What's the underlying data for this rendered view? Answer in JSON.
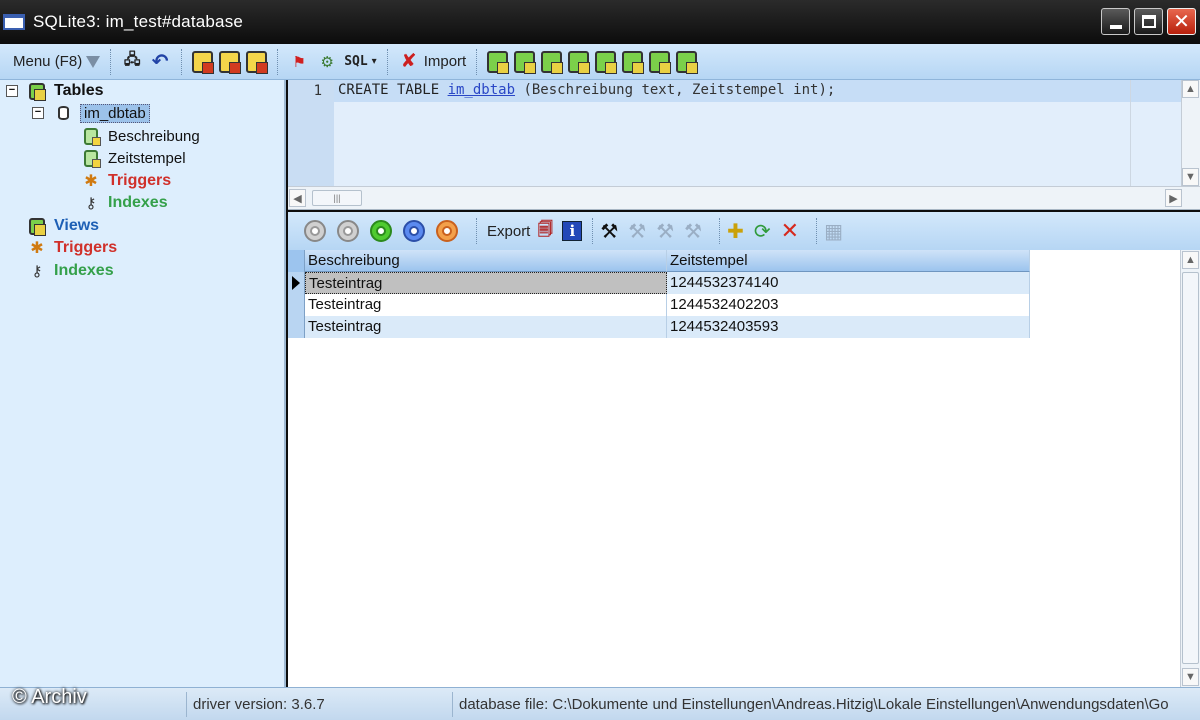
{
  "window": {
    "title": "SQLite3: im_test#database"
  },
  "toolbar": {
    "menu_label": "Menu (F8)",
    "sql_label": "SQL",
    "import_label": "Import"
  },
  "tree": {
    "tables": "Tables",
    "table_name": "im_dbtab",
    "column_1": "Beschreibung",
    "column_2": "Zeitstempel",
    "sub_triggers": "Triggers",
    "sub_indexes": "Indexes",
    "views": "Views",
    "triggers": "Triggers",
    "indexes": "Indexes"
  },
  "editor": {
    "line_number": "1",
    "kw_create": "CREATE TABLE ",
    "ident": "im_dbtab",
    "rest": " (Beschreibung text, Zeitstempel int);"
  },
  "gridbar": {
    "export_label": "Export"
  },
  "grid": {
    "headers": [
      "Beschreibung",
      "Zeitstempel"
    ],
    "rows": [
      [
        "Testeintrag",
        "1244532374140"
      ],
      [
        "Testeintrag",
        "1244532402203"
      ],
      [
        "Testeintrag",
        "1244532403593"
      ]
    ]
  },
  "statusbar": {
    "driver": "driver version: 3.6.7",
    "file": "database file: C:\\Dokumente und Einstellungen\\Andreas.Hitzig\\Lokale Einstellungen\\Anwendungsdaten\\Go"
  },
  "watermark": "© Archiv"
}
